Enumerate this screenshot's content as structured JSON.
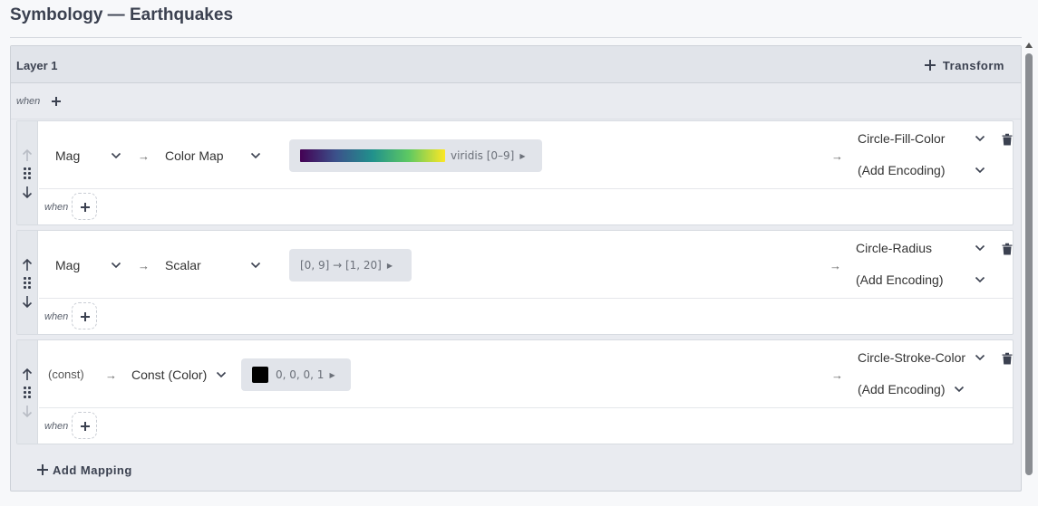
{
  "title": "Symbology — Earthquakes",
  "layer": {
    "name": "Layer 1",
    "transform_label": "Transform",
    "when_label": "when"
  },
  "mappings": [
    {
      "source": "Mag",
      "arrow": "→",
      "function": "Color Map",
      "param": "viridis [0–9]",
      "param_icon": "gradient-swatch",
      "output_arrow": "→",
      "encoding": "Circle-Fill-Color",
      "add_encoding": "(Add Encoding)",
      "when_label": "when"
    },
    {
      "source": "Mag",
      "arrow": "→",
      "function": "Scalar",
      "param": "[0, 9] → [1, 20]",
      "output_arrow": "→",
      "encoding": "Circle-Radius",
      "add_encoding": "(Add Encoding)",
      "when_label": "when"
    },
    {
      "source": "(const)",
      "arrow": "→",
      "function": "Const (Color)",
      "param": "0, 0, 0, 1",
      "param_color": "#000000",
      "output_arrow": "→",
      "encoding": "Circle-Stroke-Color",
      "add_encoding": "(Add Encoding)",
      "when_label": "when"
    }
  ],
  "add_mapping_label": "Add Mapping",
  "icons": [
    "plus-icon",
    "arrow-up-icon",
    "arrow-down-icon",
    "drag-handle-icon",
    "chevron-down-icon",
    "trash-icon",
    "caret-right-icon"
  ],
  "colors": {
    "layer_bg": "#e9ebf0",
    "header_bg": "#e1e4ea",
    "text_dark": "#3b4150",
    "pill_bg": "#e1e4ea"
  }
}
